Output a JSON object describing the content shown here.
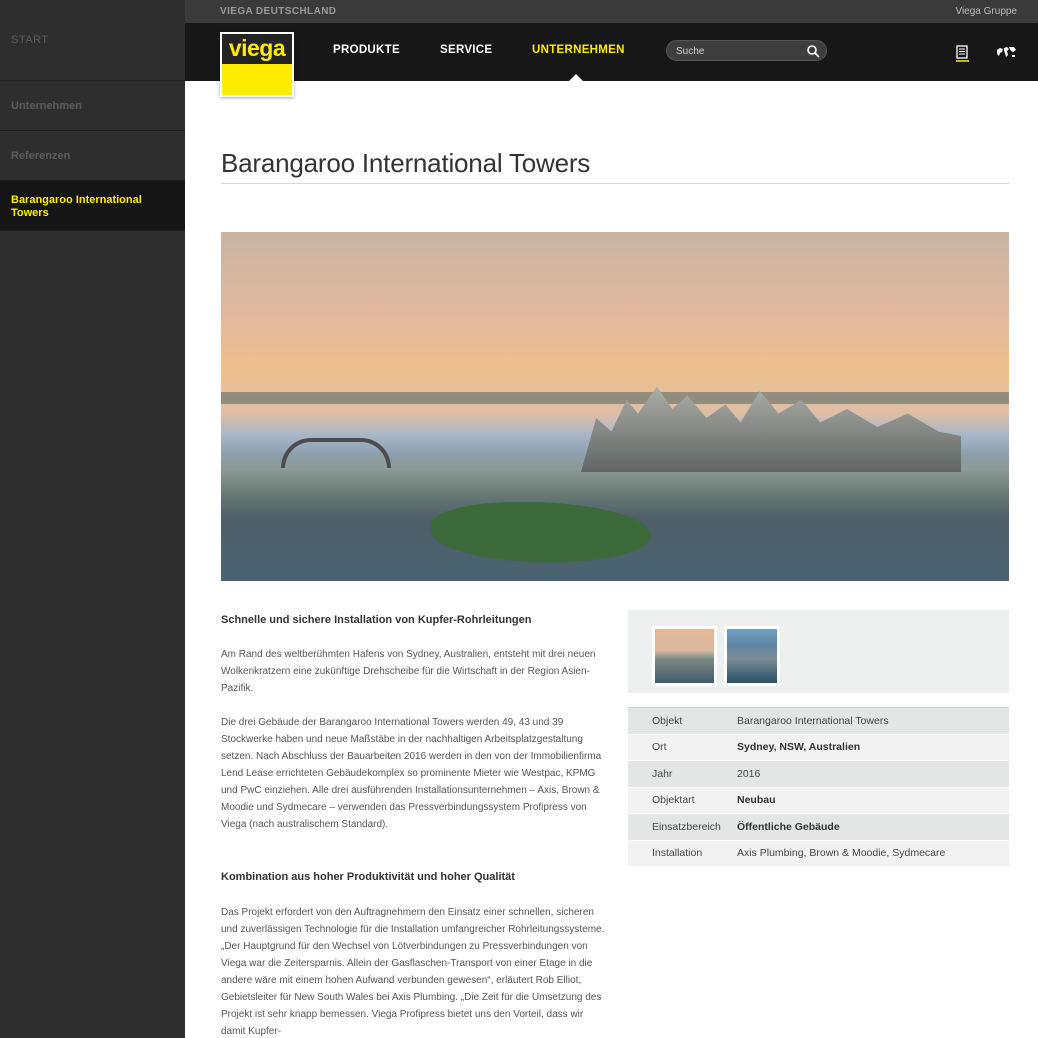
{
  "sidebar": {
    "start": "START",
    "items": [
      {
        "label": "Unternehmen"
      },
      {
        "label": "Referenzen"
      },
      {
        "label": "Barangaroo International Towers"
      }
    ]
  },
  "topbar": {
    "brand": "VIEGA DEUTSCHLAND",
    "group_link": "Viega Gruppe"
  },
  "header": {
    "logo_text": "viega",
    "nav": [
      {
        "label": "PRODUKTE"
      },
      {
        "label": "SERVICE"
      },
      {
        "label": "UNTERNEHMEN"
      }
    ],
    "search": {
      "placeholder": "Suche",
      "icon": "search-icon"
    },
    "icons": [
      "document-list-icon",
      "world-map-icon"
    ]
  },
  "page": {
    "title": "Barangaroo International Towers",
    "section1_heading": "Schnelle und sichere Installation von Kupfer-Rohrleitungen",
    "section1_para1": "Am Rand des weltberühmten Hafens von Sydney, Australien, entsteht mit drei neuen Wolkenkratzern eine zukünftige Drehscheibe für die Wirtschaft in der Region Asien-Pazifik.",
    "section1_para2": "Die drei Gebäude der Barangaroo International Towers werden 49, 43 und 39 Stockwerke haben und neue Maßstäbe in der nachhaltigen Arbeitsplatzgestaltung setzen. Nach Abschluss der Bauarbeiten 2016 werden in den von der Immobilienfirma Lend Lease errichteten Gebäudekomplex so prominente Mieter wie Westpac, KPMG und PwC einziehen. Alle drei ausführenden Installationsunternehmen – Axis, Brown & Moodie und Sydmecare – verwenden das Pressverbindungssystem Profipress von Viega (nach australischem Standard).",
    "section2_heading": "Kombination aus hoher Produktivität und hoher Qualität",
    "section2_para1": "Das Projekt erfordert von den Auftragnehmern den Einsatz einer schnellen, sicheren und zuverlässigen Technologie für die Installation umfangreicher Rohrleitungssysteme. „Der Hauptgrund für den Wechsel von Lötverbindungen zu Pressverbindungen von Viega war die Zeitersparnis. Allein der Gasflaschen-Transport von einer Etage in die andere wäre mit einem hohen Aufwand verbunden gewesen“, erläutert Rob Elliot, Gebietsleiter für New South Wales bei Axis Plumbing. „Die Zeit für die Umsetzung des Projekt ist sehr knapp bemessen. Viega Profipress bietet uns den Vorteil, dass wir damit Kupfer-"
  },
  "info_table": [
    {
      "key": "Objekt",
      "value": "Barangaroo International Towers",
      "bold": false
    },
    {
      "key": "Ort",
      "value": "Sydney, NSW, Australien",
      "bold": true
    },
    {
      "key": "Jahr",
      "value": "2016",
      "bold": false
    },
    {
      "key": "Objektart",
      "value": "Neubau",
      "bold": true
    },
    {
      "key": "Einsatzbereich",
      "value": "Öffentliche Gebäude",
      "bold": true
    },
    {
      "key": "Installation",
      "value": "Axis Plumbing, Brown & Moodie, Sydmecare",
      "bold": false
    }
  ],
  "colors": {
    "accent": "#ffed00",
    "sidebar_bg": "#2e2e2e",
    "header_bg": "#171717"
  }
}
